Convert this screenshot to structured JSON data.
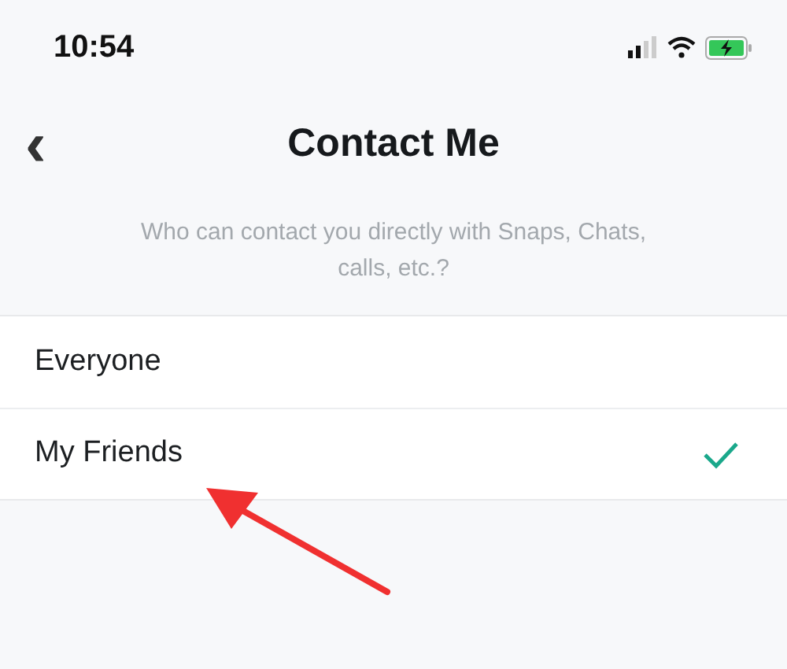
{
  "status_bar": {
    "time": "10:54"
  },
  "nav": {
    "back": "‹",
    "title": "Contact Me"
  },
  "description": "Who can contact you directly with Snaps, Chats, calls, etc.?",
  "options": [
    {
      "label": "Everyone",
      "selected": false
    },
    {
      "label": "My Friends",
      "selected": true
    }
  ],
  "annotation": {
    "kind": "arrow",
    "color": "#f03030"
  }
}
